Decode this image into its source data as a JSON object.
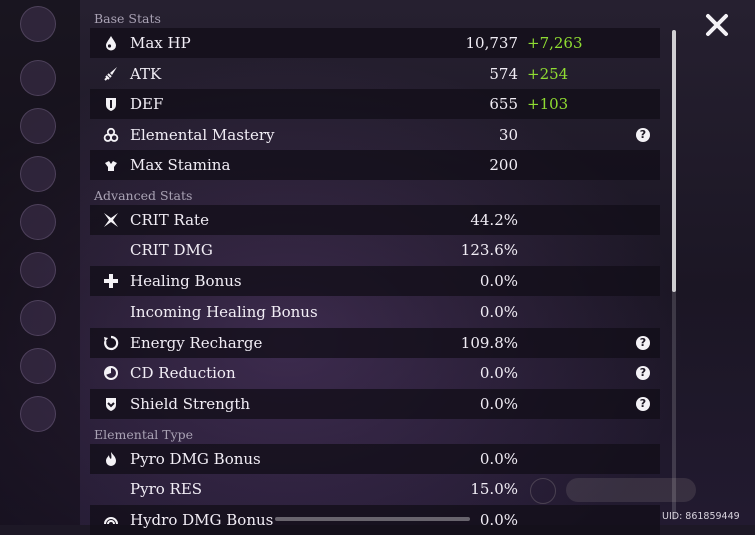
{
  "sections": {
    "base": "Base Stats",
    "advanced": "Advanced Stats",
    "elemental": "Elemental Type"
  },
  "stats": {
    "max_hp": {
      "label": "Max HP",
      "value": "10,737",
      "bonus": "+7,263"
    },
    "atk": {
      "label": "ATK",
      "value": "574",
      "bonus": "+254"
    },
    "def": {
      "label": "DEF",
      "value": "655",
      "bonus": "+103"
    },
    "em": {
      "label": "Elemental Mastery",
      "value": "30"
    },
    "stamina": {
      "label": "Max Stamina",
      "value": "200"
    },
    "crit_rate": {
      "label": "CRIT Rate",
      "value": "44.2%"
    },
    "crit_dmg": {
      "label": "CRIT DMG",
      "value": "123.6%"
    },
    "healing": {
      "label": "Healing Bonus",
      "value": "0.0%"
    },
    "incoming_healing": {
      "label": "Incoming Healing Bonus",
      "value": "0.0%"
    },
    "energy": {
      "label": "Energy Recharge",
      "value": "109.8%"
    },
    "cd": {
      "label": "CD Reduction",
      "value": "0.0%"
    },
    "shield": {
      "label": "Shield Strength",
      "value": "0.0%"
    },
    "pyro_dmg": {
      "label": "Pyro DMG Bonus",
      "value": "0.0%"
    },
    "pyro_res": {
      "label": "Pyro RES",
      "value": "15.0%"
    },
    "hydro_dmg": {
      "label": "Hydro DMG Bonus",
      "value": "0.0%"
    }
  },
  "help_glyph": "?",
  "uid": "UID: 861859449",
  "colors": {
    "bonus": "#8fdc32",
    "row_bg": "#120e18",
    "text": "#f1edf5"
  }
}
